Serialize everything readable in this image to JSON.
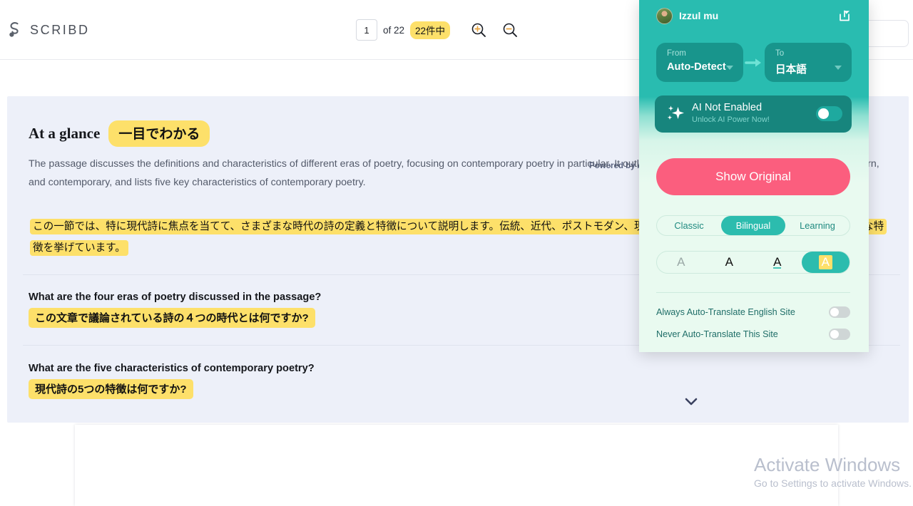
{
  "header": {
    "brand": "SCRIBD",
    "brand_icon": "scribd-logo-icon",
    "page_number": "1",
    "page_of": "of 22",
    "page_of_translated": "22件中",
    "zoom_in_icon": "zoom-in-icon",
    "zoom_out_icon": "zoom-out-icon",
    "search_placeholder": ""
  },
  "document": {
    "glance_title_en": "At a glance",
    "glance_title_ja": "一目でわかる",
    "powered_by": "Powered by A",
    "summary_en": "The passage discusses the definitions and characteristics of different eras of poetry, focusing on contemporary poetry in particular. It outlines the four eras as traditional, modern, postmodern, and contemporary, and lists five key characteristics of contemporary poetry.",
    "summary_ja": "この一節では、特に現代詩に焦点を当てて、さまざまな時代の詩の定義と特徴について説明します。伝統、近代、ポストモダン、現代の４つの時代を概説し、現代詩の５つの主要な特徴を挙げています。",
    "questions": [
      {
        "en": "What are the four eras of poetry discussed in the passage?",
        "ja": "この文章で議論されている詩の４つの時代とは何ですか?"
      },
      {
        "en": "What are the five characteristics of contemporary poetry?",
        "ja": "現代詩の5つの特徴は何ですか?"
      }
    ],
    "expand_icon": "chevron-down-icon"
  },
  "watermark": {
    "title": "Activate Windows",
    "subtitle": "Go to Settings to activate Windows."
  },
  "popup": {
    "user_name": "Izzul mu",
    "avatar_icon": "user-avatar",
    "share_icon": "share-icon",
    "from_label": "From",
    "from_value": "Auto-Detect",
    "to_label": "To",
    "to_value": "日本語",
    "arrow_icon": "arrow-right-icon",
    "ai_icon": "sparkle-icon",
    "ai_title": "AI Not Enabled",
    "ai_subtitle": "Unlock AI Power Now!",
    "show_original": "Show Original",
    "modes": [
      {
        "label": "Classic",
        "active": false
      },
      {
        "label": "Bilingual",
        "active": true
      },
      {
        "label": "Learning",
        "active": false
      }
    ],
    "styles": [
      {
        "label": "A",
        "name": "style-faded"
      },
      {
        "label": "A",
        "name": "style-bold"
      },
      {
        "label": "A",
        "name": "style-underline"
      },
      {
        "label": "A",
        "name": "style-highlight"
      }
    ],
    "options": [
      {
        "label": "Always Auto-Translate English Site"
      },
      {
        "label": "Never Auto-Translate This Site"
      }
    ],
    "colors": {
      "teal": "#29bcb0",
      "teal_dark": "#17857d",
      "pink": "#fb5e7e",
      "highlight_yellow": "#fde06a"
    }
  }
}
